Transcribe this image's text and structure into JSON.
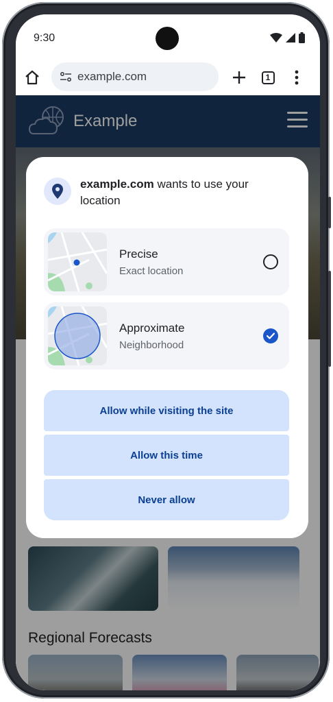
{
  "status_bar": {
    "time": "9:30"
  },
  "toolbar": {
    "url": "example.com",
    "tab_count": "1"
  },
  "site": {
    "title": "Example",
    "section_title": "Regional Forecasts"
  },
  "dialog": {
    "origin": "example.com",
    "message": " wants to use your location",
    "options": [
      {
        "label": "Precise",
        "sublabel": "Exact location",
        "selected": false
      },
      {
        "label": "Approximate",
        "sublabel": "Neighborhood",
        "selected": true
      }
    ],
    "actions": {
      "allow_while_visiting": "Allow while visiting the site",
      "allow_this_time": "Allow this time",
      "never_allow": "Never allow"
    }
  },
  "colors": {
    "accent": "#1a56c9",
    "button_bg": "#d3e3fd",
    "button_text": "#0b3f91",
    "header_bg": "#1c3a63"
  }
}
